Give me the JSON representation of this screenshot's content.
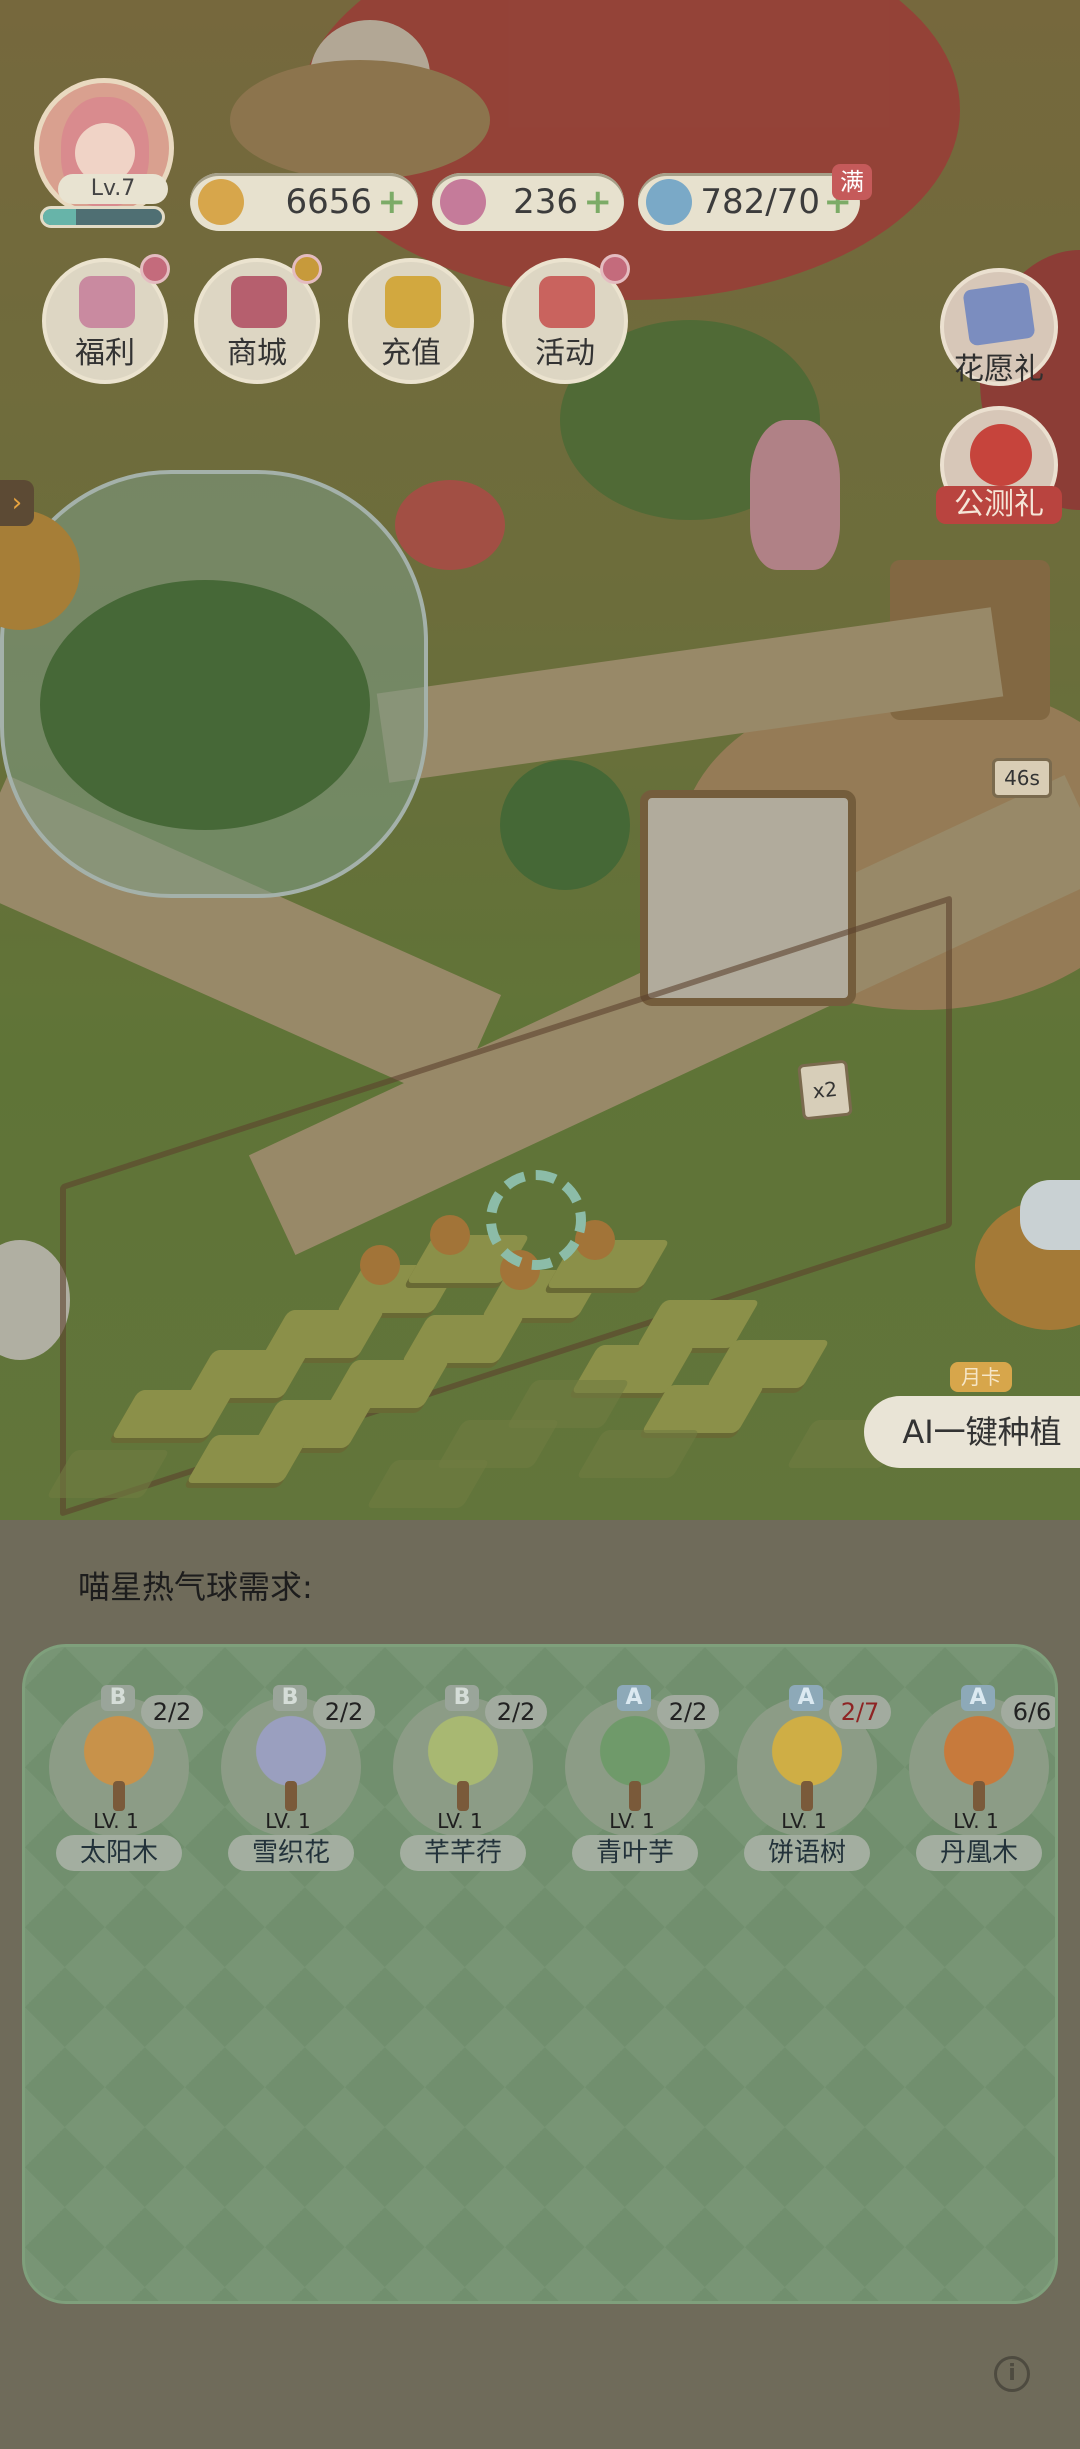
{
  "hud": {
    "level": "Lv.7",
    "xp_progress": 0.28,
    "coins": "6656",
    "stars": "236",
    "water": "782/70",
    "plus": "+",
    "full_badge": "满"
  },
  "menu": [
    {
      "label": "福利",
      "icon": "gift-icon"
    },
    {
      "label": "商城",
      "icon": "shop-cart-icon"
    },
    {
      "label": "充值",
      "icon": "recharge-icon"
    },
    {
      "label": "活动",
      "icon": "gamepad-icon"
    }
  ],
  "side": {
    "flower_wish": "花愿礼",
    "beta_gift": "公测礼"
  },
  "scene": {
    "timer": "46s",
    "multiplier": "x2",
    "month_card": "月卡",
    "ai_plant": "AI一键种植"
  },
  "panel": {
    "title": "喵星热气球需求:",
    "plants": [
      {
        "grade": "B",
        "count": "2/2",
        "count_alert": false,
        "level": "LV. 1",
        "name": "太阳木",
        "color": "#c8924a"
      },
      {
        "grade": "B",
        "count": "2/2",
        "count_alert": false,
        "level": "LV. 1",
        "name": "雪织花",
        "color": "#9a9fbf"
      },
      {
        "grade": "B",
        "count": "2/2",
        "count_alert": false,
        "level": "LV. 1",
        "name": "芊芊荇",
        "color": "#a8b872"
      },
      {
        "grade": "A",
        "count": "2/2",
        "count_alert": false,
        "level": "LV. 1",
        "name": "青叶芋",
        "color": "#6f9a6a"
      },
      {
        "grade": "A",
        "count": "2/7",
        "count_alert": true,
        "level": "LV. 1",
        "name": "饼语树",
        "color": "#cfae45"
      },
      {
        "grade": "A",
        "count": "6/6",
        "count_alert": false,
        "level": "LV. 1",
        "name": "丹凰木",
        "color": "#c77a3c"
      }
    ],
    "info": "i"
  },
  "colors": {
    "panel_bg": "#6f6b5a",
    "card_bg": "#718f6e",
    "beta_red": "#b9443f"
  }
}
